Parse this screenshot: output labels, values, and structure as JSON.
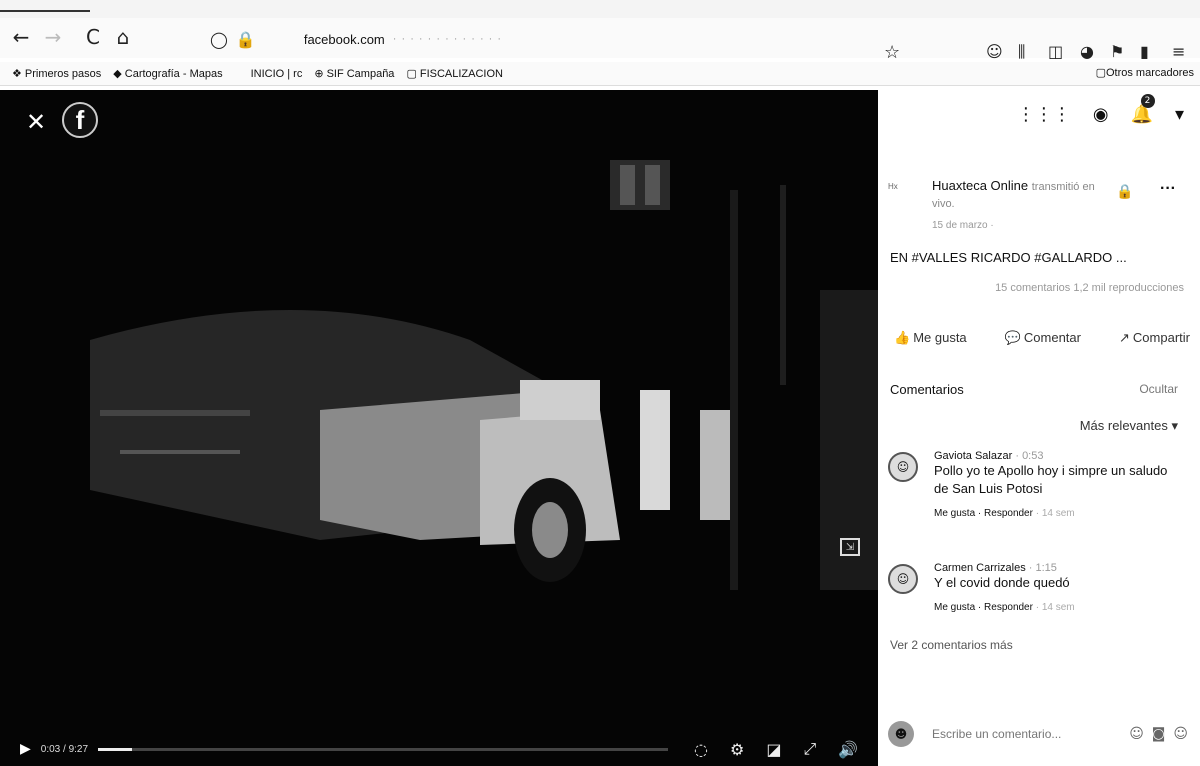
{
  "browser": {
    "back_icon": "←",
    "forward_icon": "→",
    "reload_icon": "C",
    "home_icon": "⌂",
    "shield_icon": "◯",
    "lock_icon": "🔒",
    "url_domain": "facebook.com",
    "url_path": "· · · · · · · · · · · · ·",
    "bookmark_star": "☆"
  },
  "bookmarks": [
    {
      "icon": "❖",
      "label": "Primeros pasos"
    },
    {
      "icon": "◆",
      "label": "Cartografía - Mapas"
    },
    {
      "icon": "",
      "label": "INICIO | rc"
    },
    {
      "icon": "⊕",
      "label": "SIF Campaña"
    },
    {
      "icon": "▢",
      "label": "FISCALIZACION"
    }
  ],
  "other_bookmarks": "Otros marcadores",
  "video": {
    "close_icon": "✕",
    "logo_letter": "f",
    "time": "0:03 / 9:27",
    "progress_fraction": 0.06,
    "pip_label": "⇲"
  },
  "panel": {
    "notifications_count": "2",
    "author": "Huaxteca Online",
    "author_action": "transmitió en vivo.",
    "date": "15 de marzo ·",
    "avatar_text": "Hx",
    "title": "EN #VALLES RICARDO #GALLARDO ...",
    "stats": "15 comentarios  1,2 mil reproducciones",
    "like": "Me gusta",
    "comment": "Comentar",
    "share": "Compartir",
    "comments_heading": "Comentarios",
    "hide": "Ocultar",
    "relevance": "Más relevantes ▾",
    "more_comments": "Ver 2 comentarios más",
    "composer_placeholder": "Escribe un comentario..."
  },
  "comments": [
    {
      "author": "Gaviota Salazar",
      "time": "0:53",
      "text": "Pollo yo te Apollo hoy i simpre un saludo de San Luis Potosi",
      "like": "Me gusta",
      "reply": "Responder",
      "age": "14 sem"
    },
    {
      "author": "Carmen Carrizales",
      "time": "1:15",
      "text": "Y el covid donde quedó",
      "like": "Me gusta",
      "reply": "Responder",
      "age": "14 sem"
    }
  ]
}
